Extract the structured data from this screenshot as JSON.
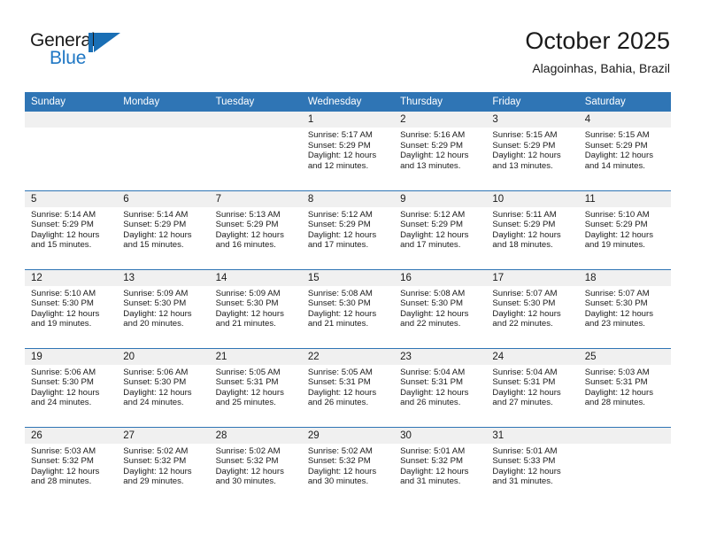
{
  "logo": {
    "word_primary": "General",
    "word_secondary": "Blue",
    "mark_name": "blue-flag-mark"
  },
  "header": {
    "title": "October 2025",
    "subtitle": "Alagoinhas, Bahia, Brazil"
  },
  "colors": {
    "header_blue": "#2f75b5",
    "logo_blue": "#1f77c4",
    "daynum_band": "#f0f0f0",
    "text": "#1a1a1a"
  },
  "calendar": {
    "weekday_headers": [
      "Sunday",
      "Monday",
      "Tuesday",
      "Wednesday",
      "Thursday",
      "Friday",
      "Saturday"
    ],
    "labels": {
      "sunrise": "Sunrise:",
      "sunset": "Sunset:",
      "daylight": "Daylight:"
    },
    "weeks": [
      [
        {
          "day": "",
          "empty": true
        },
        {
          "day": "",
          "empty": true
        },
        {
          "day": "",
          "empty": true
        },
        {
          "day": "1",
          "sunrise": "Sunrise: 5:17 AM",
          "sunset": "Sunset: 5:29 PM",
          "daylight_1": "Daylight: 12 hours",
          "daylight_2": "and 12 minutes."
        },
        {
          "day": "2",
          "sunrise": "Sunrise: 5:16 AM",
          "sunset": "Sunset: 5:29 PM",
          "daylight_1": "Daylight: 12 hours",
          "daylight_2": "and 13 minutes."
        },
        {
          "day": "3",
          "sunrise": "Sunrise: 5:15 AM",
          "sunset": "Sunset: 5:29 PM",
          "daylight_1": "Daylight: 12 hours",
          "daylight_2": "and 13 minutes."
        },
        {
          "day": "4",
          "sunrise": "Sunrise: 5:15 AM",
          "sunset": "Sunset: 5:29 PM",
          "daylight_1": "Daylight: 12 hours",
          "daylight_2": "and 14 minutes."
        }
      ],
      [
        {
          "day": "5",
          "sunrise": "Sunrise: 5:14 AM",
          "sunset": "Sunset: 5:29 PM",
          "daylight_1": "Daylight: 12 hours",
          "daylight_2": "and 15 minutes."
        },
        {
          "day": "6",
          "sunrise": "Sunrise: 5:14 AM",
          "sunset": "Sunset: 5:29 PM",
          "daylight_1": "Daylight: 12 hours",
          "daylight_2": "and 15 minutes."
        },
        {
          "day": "7",
          "sunrise": "Sunrise: 5:13 AM",
          "sunset": "Sunset: 5:29 PM",
          "daylight_1": "Daylight: 12 hours",
          "daylight_2": "and 16 minutes."
        },
        {
          "day": "8",
          "sunrise": "Sunrise: 5:12 AM",
          "sunset": "Sunset: 5:29 PM",
          "daylight_1": "Daylight: 12 hours",
          "daylight_2": "and 17 minutes."
        },
        {
          "day": "9",
          "sunrise": "Sunrise: 5:12 AM",
          "sunset": "Sunset: 5:29 PM",
          "daylight_1": "Daylight: 12 hours",
          "daylight_2": "and 17 minutes."
        },
        {
          "day": "10",
          "sunrise": "Sunrise: 5:11 AM",
          "sunset": "Sunset: 5:29 PM",
          "daylight_1": "Daylight: 12 hours",
          "daylight_2": "and 18 minutes."
        },
        {
          "day": "11",
          "sunrise": "Sunrise: 5:10 AM",
          "sunset": "Sunset: 5:29 PM",
          "daylight_1": "Daylight: 12 hours",
          "daylight_2": "and 19 minutes."
        }
      ],
      [
        {
          "day": "12",
          "sunrise": "Sunrise: 5:10 AM",
          "sunset": "Sunset: 5:30 PM",
          "daylight_1": "Daylight: 12 hours",
          "daylight_2": "and 19 minutes."
        },
        {
          "day": "13",
          "sunrise": "Sunrise: 5:09 AM",
          "sunset": "Sunset: 5:30 PM",
          "daylight_1": "Daylight: 12 hours",
          "daylight_2": "and 20 minutes."
        },
        {
          "day": "14",
          "sunrise": "Sunrise: 5:09 AM",
          "sunset": "Sunset: 5:30 PM",
          "daylight_1": "Daylight: 12 hours",
          "daylight_2": "and 21 minutes."
        },
        {
          "day": "15",
          "sunrise": "Sunrise: 5:08 AM",
          "sunset": "Sunset: 5:30 PM",
          "daylight_1": "Daylight: 12 hours",
          "daylight_2": "and 21 minutes."
        },
        {
          "day": "16",
          "sunrise": "Sunrise: 5:08 AM",
          "sunset": "Sunset: 5:30 PM",
          "daylight_1": "Daylight: 12 hours",
          "daylight_2": "and 22 minutes."
        },
        {
          "day": "17",
          "sunrise": "Sunrise: 5:07 AM",
          "sunset": "Sunset: 5:30 PM",
          "daylight_1": "Daylight: 12 hours",
          "daylight_2": "and 22 minutes."
        },
        {
          "day": "18",
          "sunrise": "Sunrise: 5:07 AM",
          "sunset": "Sunset: 5:30 PM",
          "daylight_1": "Daylight: 12 hours",
          "daylight_2": "and 23 minutes."
        }
      ],
      [
        {
          "day": "19",
          "sunrise": "Sunrise: 5:06 AM",
          "sunset": "Sunset: 5:30 PM",
          "daylight_1": "Daylight: 12 hours",
          "daylight_2": "and 24 minutes."
        },
        {
          "day": "20",
          "sunrise": "Sunrise: 5:06 AM",
          "sunset": "Sunset: 5:30 PM",
          "daylight_1": "Daylight: 12 hours",
          "daylight_2": "and 24 minutes."
        },
        {
          "day": "21",
          "sunrise": "Sunrise: 5:05 AM",
          "sunset": "Sunset: 5:31 PM",
          "daylight_1": "Daylight: 12 hours",
          "daylight_2": "and 25 minutes."
        },
        {
          "day": "22",
          "sunrise": "Sunrise: 5:05 AM",
          "sunset": "Sunset: 5:31 PM",
          "daylight_1": "Daylight: 12 hours",
          "daylight_2": "and 26 minutes."
        },
        {
          "day": "23",
          "sunrise": "Sunrise: 5:04 AM",
          "sunset": "Sunset: 5:31 PM",
          "daylight_1": "Daylight: 12 hours",
          "daylight_2": "and 26 minutes."
        },
        {
          "day": "24",
          "sunrise": "Sunrise: 5:04 AM",
          "sunset": "Sunset: 5:31 PM",
          "daylight_1": "Daylight: 12 hours",
          "daylight_2": "and 27 minutes."
        },
        {
          "day": "25",
          "sunrise": "Sunrise: 5:03 AM",
          "sunset": "Sunset: 5:31 PM",
          "daylight_1": "Daylight: 12 hours",
          "daylight_2": "and 28 minutes."
        }
      ],
      [
        {
          "day": "26",
          "sunrise": "Sunrise: 5:03 AM",
          "sunset": "Sunset: 5:32 PM",
          "daylight_1": "Daylight: 12 hours",
          "daylight_2": "and 28 minutes."
        },
        {
          "day": "27",
          "sunrise": "Sunrise: 5:02 AM",
          "sunset": "Sunset: 5:32 PM",
          "daylight_1": "Daylight: 12 hours",
          "daylight_2": "and 29 minutes."
        },
        {
          "day": "28",
          "sunrise": "Sunrise: 5:02 AM",
          "sunset": "Sunset: 5:32 PM",
          "daylight_1": "Daylight: 12 hours",
          "daylight_2": "and 30 minutes."
        },
        {
          "day": "29",
          "sunrise": "Sunrise: 5:02 AM",
          "sunset": "Sunset: 5:32 PM",
          "daylight_1": "Daylight: 12 hours",
          "daylight_2": "and 30 minutes."
        },
        {
          "day": "30",
          "sunrise": "Sunrise: 5:01 AM",
          "sunset": "Sunset: 5:32 PM",
          "daylight_1": "Daylight: 12 hours",
          "daylight_2": "and 31 minutes."
        },
        {
          "day": "31",
          "sunrise": "Sunrise: 5:01 AM",
          "sunset": "Sunset: 5:33 PM",
          "daylight_1": "Daylight: 12 hours",
          "daylight_2": "and 31 minutes."
        },
        {
          "day": "",
          "empty": true
        }
      ]
    ]
  }
}
